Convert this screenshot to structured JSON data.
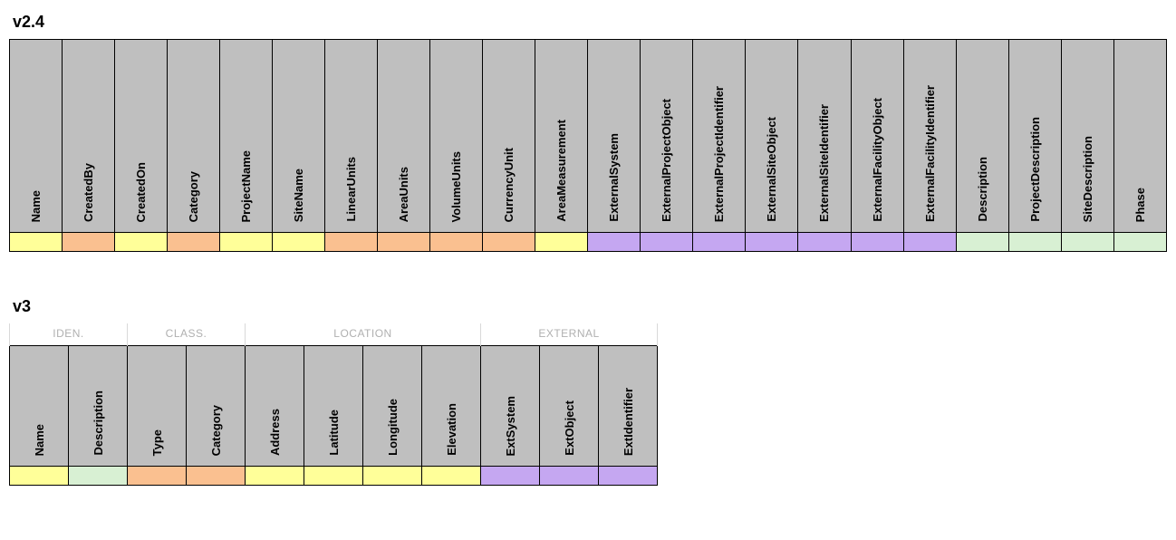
{
  "sections": {
    "v24": {
      "title": "v2.4",
      "columns": [
        {
          "label": "Name",
          "color": "yellow"
        },
        {
          "label": "CreatedBy",
          "color": "orange"
        },
        {
          "label": "CreatedOn",
          "color": "yellow"
        },
        {
          "label": "Category",
          "color": "orange"
        },
        {
          "label": "ProjectName",
          "color": "yellow"
        },
        {
          "label": "SiteName",
          "color": "yellow"
        },
        {
          "label": "LinearUnits",
          "color": "orange"
        },
        {
          "label": "AreaUnits",
          "color": "orange"
        },
        {
          "label": "VolumeUnits",
          "color": "orange"
        },
        {
          "label": "CurrencyUnit",
          "color": "orange"
        },
        {
          "label": "AreaMeasurement",
          "color": "yellow"
        },
        {
          "label": "ExternalSystem",
          "color": "purple"
        },
        {
          "label": "ExternalProjectObject",
          "color": "purple"
        },
        {
          "label": "ExternalProjectIdentifier",
          "color": "purple"
        },
        {
          "label": "ExternalSiteObject",
          "color": "purple"
        },
        {
          "label": "ExternalSiteIdentifier",
          "color": "purple"
        },
        {
          "label": "ExternalFacilityObject",
          "color": "purple"
        },
        {
          "label": "ExternalFacilityIdentifier",
          "color": "purple"
        },
        {
          "label": "Description",
          "color": "green"
        },
        {
          "label": "ProjectDescription",
          "color": "green"
        },
        {
          "label": "SiteDescription",
          "color": "green"
        },
        {
          "label": "Phase",
          "color": "green"
        }
      ]
    },
    "v3": {
      "title": "v3",
      "groups": [
        {
          "label": "IDEN.",
          "span": 2
        },
        {
          "label": "CLASS.",
          "span": 2
        },
        {
          "label": "LOCATION",
          "span": 4
        },
        {
          "label": "EXTERNAL",
          "span": 3
        }
      ],
      "columns": [
        {
          "label": "Name",
          "color": "yellow"
        },
        {
          "label": "Description",
          "color": "green"
        },
        {
          "label": "Type",
          "color": "orange"
        },
        {
          "label": "Category",
          "color": "orange"
        },
        {
          "label": "Address",
          "color": "yellow"
        },
        {
          "label": "Latitude",
          "color": "yellow"
        },
        {
          "label": "Longitude",
          "color": "yellow"
        },
        {
          "label": "Elevation",
          "color": "yellow"
        },
        {
          "label": "ExtSystem",
          "color": "purple"
        },
        {
          "label": "ExtObject",
          "color": "purple"
        },
        {
          "label": "ExtIdentifier",
          "color": "purple"
        }
      ]
    }
  }
}
